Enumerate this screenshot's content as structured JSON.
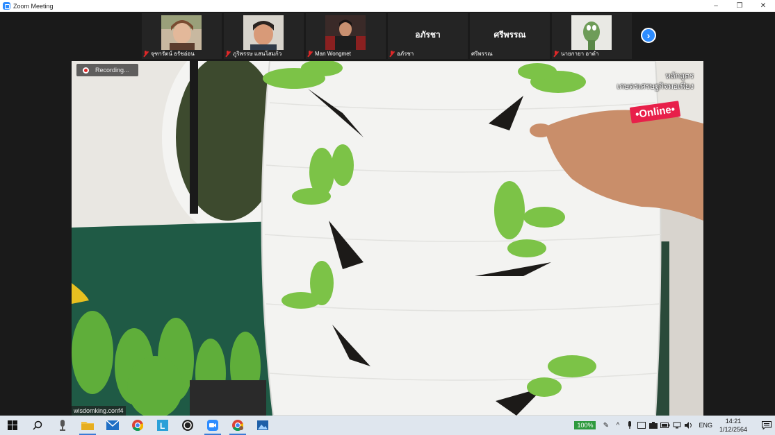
{
  "window": {
    "title": "Zoom Meeting",
    "minimize": "–",
    "restore": "❐",
    "close": "✕"
  },
  "participants": [
    {
      "name": "จุฑารัตน์ ธรัชอ่อน",
      "has_video": true
    },
    {
      "name": "ภูริพรรษ แสนโสมก้ว",
      "has_video": true
    },
    {
      "name": "Man Wongmet",
      "has_video": true
    },
    {
      "name": "อภัรชา",
      "big_name": "อภัรชา",
      "has_video": false
    },
    {
      "name": "ศรีพรรณ",
      "big_name": "ศรีพรรณ",
      "has_video": false,
      "muted": false
    },
    {
      "name": "นายกายา อาดำ",
      "has_video": true
    }
  ],
  "gallery_next_icon": "chevron-right-icon",
  "video": {
    "recording_label": "Recording...",
    "overlay_line1": "หลักสูตร",
    "overlay_line2": "เกษตรเศรษฐกิจพอเพียง",
    "online_badge": "•Online•",
    "footer_name": "wisdomking.conf4"
  },
  "taskbar": {
    "icons": [
      "windows-start-icon",
      "search-icon",
      "microphone-app-icon",
      "file-explorer-icon",
      "mail-icon",
      "chrome-icon",
      "l-app-icon",
      "obs-icon",
      "zoom-icon",
      "chrome-profile-icon",
      "photos-icon"
    ],
    "battery": "100%",
    "language": "ENG",
    "time": "14:21",
    "date": "1/12/2564"
  },
  "colors": {
    "zoom_blue": "#2d8cff",
    "muted_red": "#e02828",
    "online_pink": "#e8204a",
    "battery_green": "#2e9a3e"
  }
}
